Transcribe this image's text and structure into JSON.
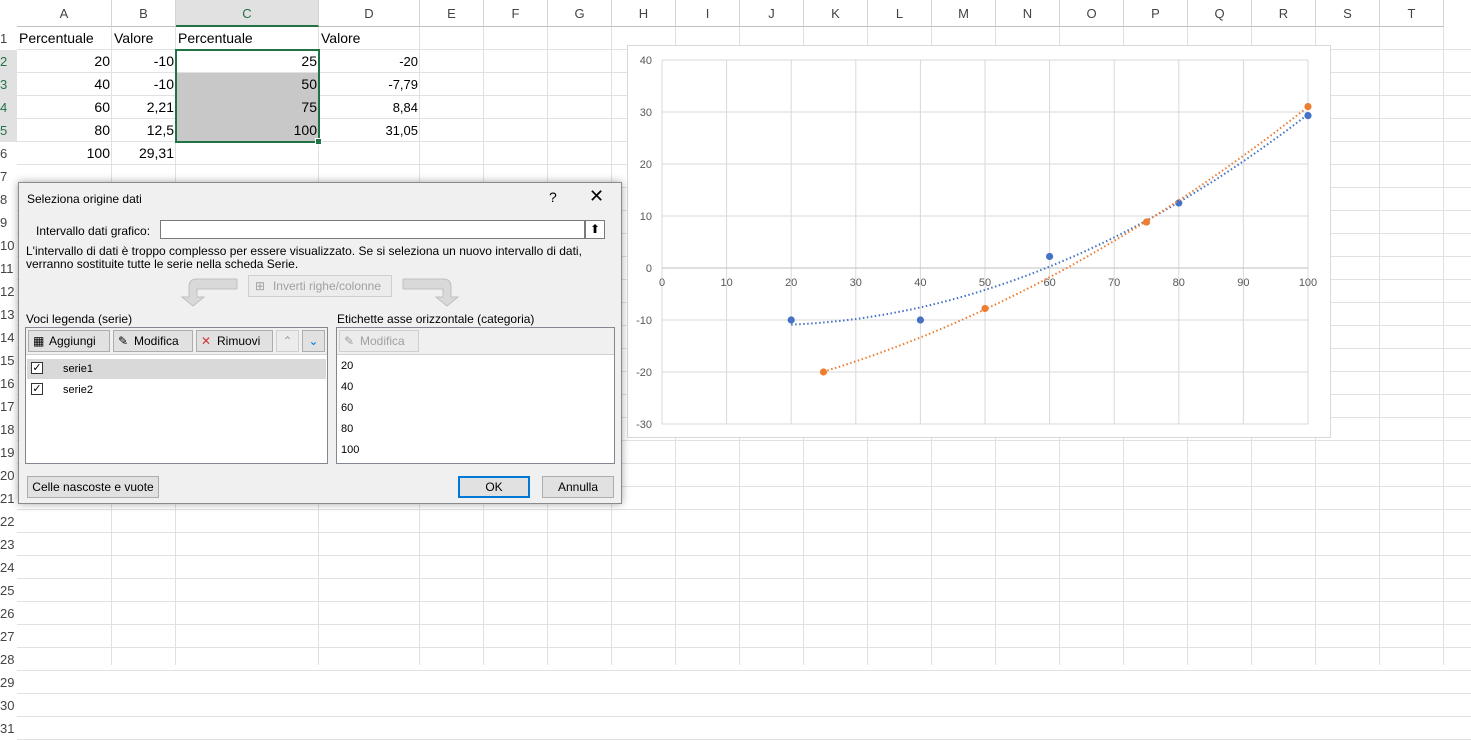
{
  "columns": [
    "A",
    "B",
    "C",
    "D",
    "E",
    "F",
    "G",
    "H",
    "I",
    "J",
    "K",
    "L",
    "M",
    "N",
    "O",
    "P",
    "Q",
    "R",
    "S",
    "T"
  ],
  "rows": [
    "1",
    "2",
    "3",
    "4",
    "5",
    "6",
    "7",
    "8",
    "9",
    "10",
    "11",
    "12",
    "13",
    "14",
    "15",
    "16",
    "17",
    "18",
    "19",
    "20",
    "21",
    "22",
    "23",
    "24",
    "25",
    "26",
    "27",
    "28",
    "29",
    "30",
    "31"
  ],
  "cells": {
    "A1": "Percentuale",
    "B1": "Valore",
    "C1": "Percentuale",
    "D1": "Valore",
    "A2": "20",
    "B2": "-10",
    "C2": "25",
    "D2": "-20",
    "A3": "40",
    "B3": "-10",
    "C3": "50",
    "D3": "-7,79",
    "A4": "60",
    "B4": "2,21",
    "C4": "75",
    "D4": "8,84",
    "A5": "80",
    "B5": "12,5",
    "C5": "100",
    "D5": "31,05",
    "A6": "100",
    "B6": "29,31"
  },
  "dialog": {
    "title": "Seleziona origine dati",
    "help": "?",
    "close": "✕",
    "range_label": "Intervallo dati grafico:",
    "range_value": "",
    "range_button_icon": "⬆",
    "message": "L'intervallo di dati è troppo complesso per essere visualizzato. Se si seleziona un nuovo intervallo di dati, verranno sostituite tutte le serie nella scheda Serie.",
    "switch_button": "Inverti righe/colonne",
    "legend_title": "Voci legenda (serie)",
    "add_button": "Aggiungi",
    "edit_button": "Modifica",
    "remove_button": "Rimuovi",
    "up_icon": "⌃",
    "down_icon": "⌄",
    "series": [
      {
        "name": "serie1",
        "checked": "✓"
      },
      {
        "name": "serie2",
        "checked": "✓"
      }
    ],
    "axis_title": "Etichette asse orizzontale (categoria)",
    "axis_edit_button": "Modifica",
    "categories": [
      "20",
      "40",
      "60",
      "80",
      "100"
    ],
    "hidden_button": "Celle nascoste e vuote",
    "ok_button": "OK",
    "cancel_button": "Annulla"
  },
  "chart_data": {
    "type": "scatter",
    "x_ticks": [
      "0",
      "10",
      "20",
      "30",
      "40",
      "50",
      "60",
      "70",
      "80",
      "90",
      "100"
    ],
    "y_ticks": [
      "40",
      "30",
      "20",
      "10",
      "0",
      "-10",
      "-20",
      "-30"
    ],
    "xlim": [
      0,
      100
    ],
    "ylim": [
      -30,
      40
    ],
    "grid": true,
    "trendline": "polynomial, dotted",
    "series": [
      {
        "color": "#4472c4",
        "x": [
          20,
          40,
          60,
          80,
          100
        ],
        "y": [
          -10,
          -10,
          2.21,
          12.5,
          29.31
        ]
      },
      {
        "color": "#ed7d31",
        "x": [
          25,
          50,
          75,
          100
        ],
        "y": [
          -20,
          -7.79,
          8.84,
          31.05
        ]
      }
    ]
  }
}
